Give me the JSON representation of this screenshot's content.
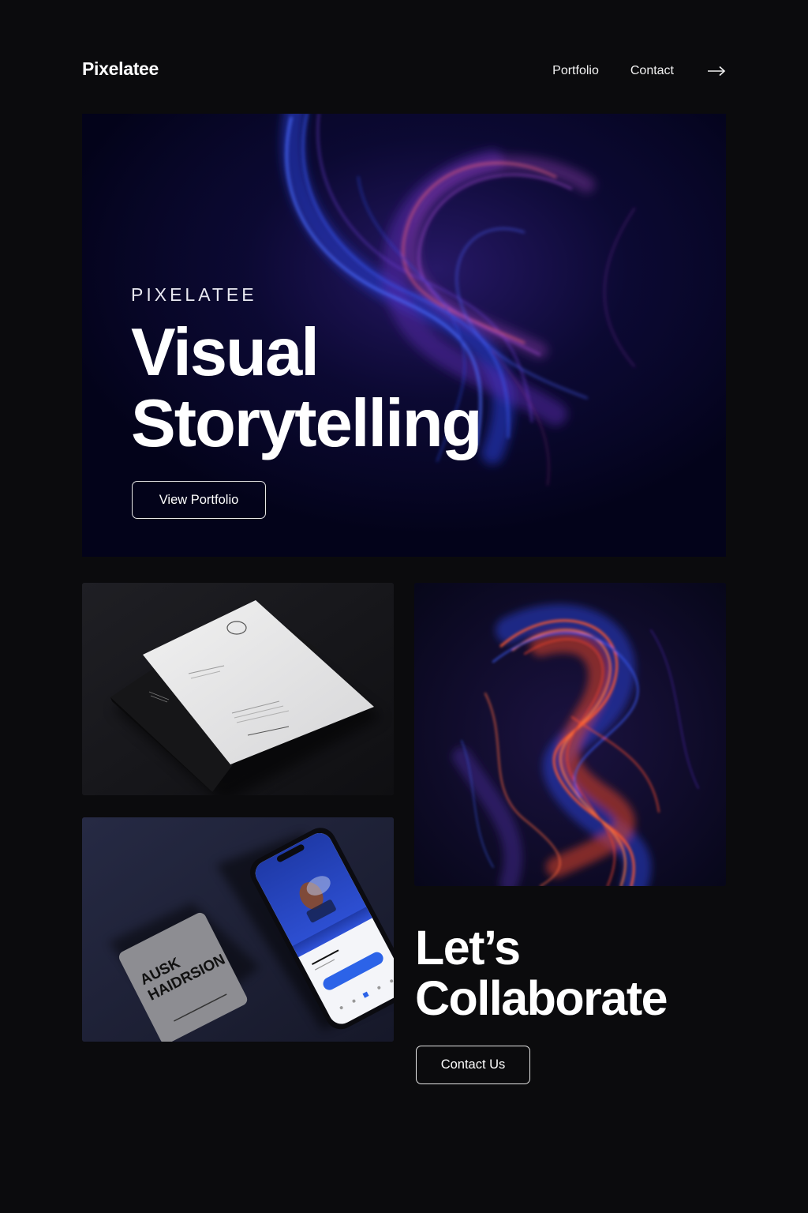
{
  "brand": {
    "name": "Pixelatee"
  },
  "nav": {
    "items": [
      {
        "label": "Portfolio"
      },
      {
        "label": "Contact"
      }
    ],
    "arrow_icon": "arrow-right-icon"
  },
  "hero": {
    "eyebrow": "PIXELATEE",
    "title_line1": "Visual",
    "title_line2": "Storytelling",
    "cta_label": "View Portfolio"
  },
  "gallery": {
    "phone_card_text_line1": "AUSK",
    "phone_card_text_line2": "HAIDRSION"
  },
  "collaborate": {
    "title_line1": "Let’s",
    "title_line2": "Collaborate",
    "cta_label": "Contact Us"
  },
  "colors": {
    "background": "#0b0b0d",
    "hero_background": "#05051a",
    "accent_blue": "#2c63e8",
    "accent_orange": "#ff5a2e",
    "text": "#ffffff"
  }
}
